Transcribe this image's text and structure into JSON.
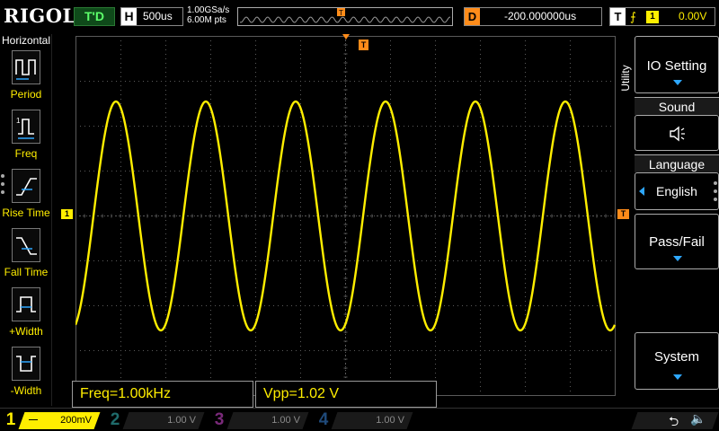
{
  "topbar": {
    "logo": "RIGOL",
    "run_state": "T'D",
    "horizontal_letter": "H",
    "timebase": "500us",
    "sample_rate": "1.00GSa/s",
    "memory_depth": "6.00M pts",
    "delay_letter": "D",
    "delay": "-200.000000us",
    "trigger_letter": "T",
    "trigger_source": "1",
    "trigger_level": "0.00V"
  },
  "left_menu": {
    "title": "Horizontal",
    "items": [
      {
        "label": "Period",
        "icon": "period-icon"
      },
      {
        "label": "Freq",
        "icon": "frequency-icon"
      },
      {
        "label": "Rise Time",
        "icon": "rise-time-icon"
      },
      {
        "label": "Fall Time",
        "icon": "fall-time-icon"
      },
      {
        "label": "+Width",
        "icon": "positive-width-icon"
      },
      {
        "label": "-Width",
        "icon": "negative-width-icon"
      }
    ]
  },
  "markers": {
    "trigger_position": "T",
    "channel1": "1",
    "trigger_level": "T"
  },
  "measurements": [
    {
      "label": "Freq=1.00kHz"
    },
    {
      "label": "Vpp=1.02 V"
    }
  ],
  "right_menu": {
    "side_tab": "Utility",
    "io_setting": "IO Setting",
    "sound_header": "Sound",
    "language_header": "Language",
    "language_value": "English",
    "pass_fail": "Pass/Fail",
    "system": "System"
  },
  "channels": [
    {
      "number": "1",
      "scale": "200mV",
      "color": "#ffee00",
      "active": true
    },
    {
      "number": "2",
      "scale": "1.00 V",
      "color": "#1f6b6b",
      "active": false
    },
    {
      "number": "3",
      "scale": "1.00 V",
      "color": "#7a2a7a",
      "active": false
    },
    {
      "number": "4",
      "scale": "1.00 V",
      "color": "#1f4a7a",
      "active": false
    }
  ],
  "waveform": {
    "channel": "1",
    "color": "#ffee00",
    "frequency_khz": 1.0,
    "vpp_v": 1.02,
    "vertical_scale_v_per_div": 0.2,
    "timebase_us_per_div": 500,
    "horizontal_divisions": 12,
    "vertical_divisions": 8
  },
  "colors": {
    "grid": "#5a5a5a",
    "trace": "#ffee00",
    "trigger": "#ff8c1a",
    "accent_blue": "#2ea8ff"
  }
}
